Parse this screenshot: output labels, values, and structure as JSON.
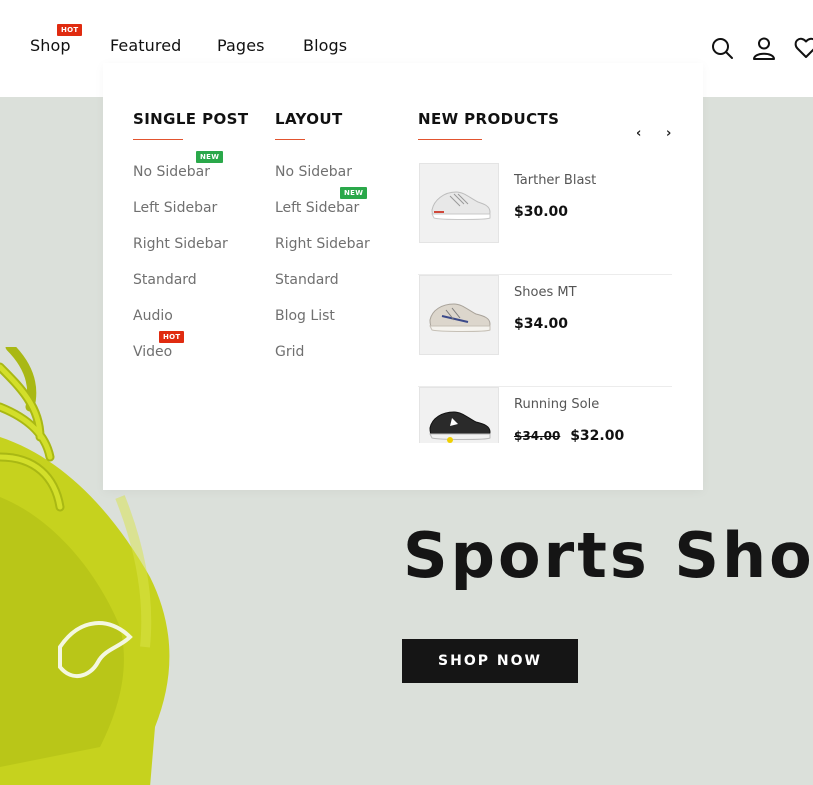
{
  "nav": {
    "items": [
      {
        "label": "Shop",
        "badge": "HOT"
      },
      {
        "label": "Featured"
      },
      {
        "label": "Pages"
      },
      {
        "label": "Blogs"
      }
    ],
    "icons": [
      "search-icon",
      "user-icon",
      "heart-icon"
    ]
  },
  "mega_menu": {
    "single_post": {
      "title": "SINGLE POST",
      "links": [
        {
          "label": "No Sidebar",
          "badge": "NEW"
        },
        {
          "label": "Left Sidebar"
        },
        {
          "label": "Right Sidebar"
        },
        {
          "label": "Standard"
        },
        {
          "label": "Audio"
        },
        {
          "label": "Video",
          "badge": "HOT"
        }
      ]
    },
    "layout": {
      "title": "LAYOUT",
      "links": [
        {
          "label": "No Sidebar"
        },
        {
          "label": "Left Sidebar",
          "badge": "NEW"
        },
        {
          "label": "Right Sidebar"
        },
        {
          "label": "Standard"
        },
        {
          "label": "Blog List"
        },
        {
          "label": "Grid"
        }
      ]
    },
    "new_products": {
      "title": "NEW PRODUCTS",
      "prev": "‹",
      "next": "›",
      "items": [
        {
          "name": "Tarther Blast",
          "price": "$30.00"
        },
        {
          "name": "Shoes MT",
          "price": "$34.00"
        },
        {
          "name": "Running Sole",
          "old_price": "$34.00",
          "price": "$32.00"
        }
      ]
    }
  },
  "hero": {
    "title": "Sports Shoes",
    "button": "SHOP NOW"
  },
  "colors": {
    "hot_badge": "#e02b10",
    "new_badge": "#2aa84a",
    "underline_accent": "#e2542f",
    "hero_bg": "#dbe0da",
    "button_bg": "#151515"
  }
}
